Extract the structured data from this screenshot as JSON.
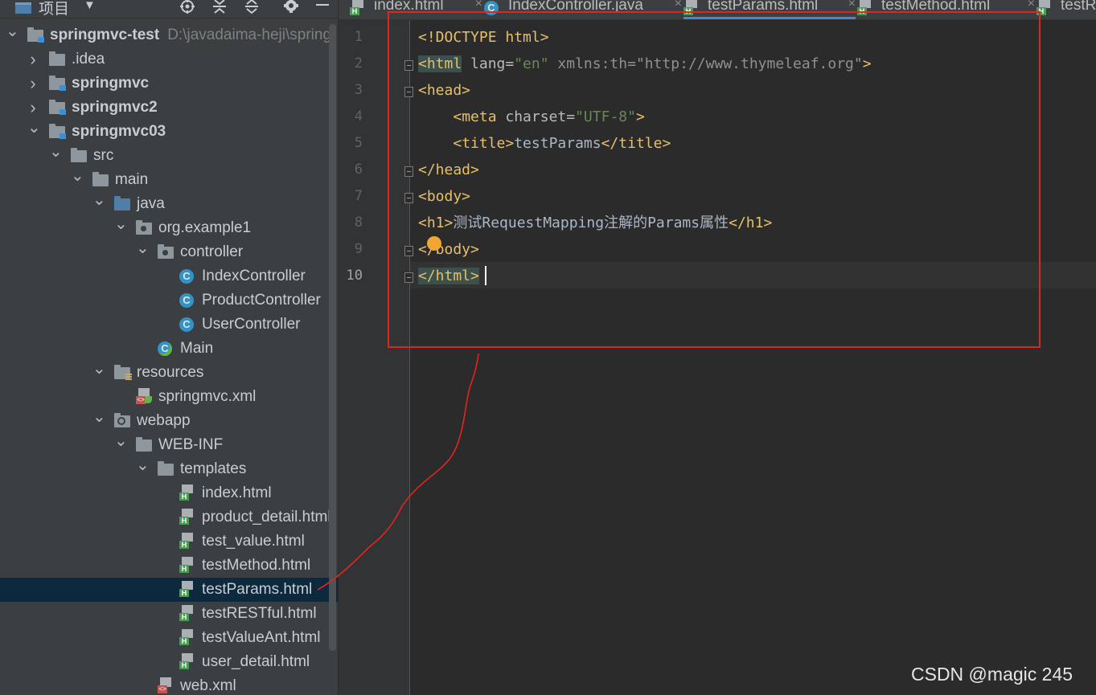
{
  "colors": {
    "panel_bg": "#3c3f41",
    "editor_bg": "#2b2b2b",
    "tag": "#e8bf6a",
    "string": "#6a8759",
    "selection": "#0d293e",
    "annotation": "#e0261e"
  },
  "project_panel": {
    "title": "项目",
    "toolbar_icons": [
      "folder-icon",
      "dropdown-arrow-icon",
      "locate-icon",
      "expand-all-icon",
      "collapse-all-icon",
      "gear-icon",
      "minimize-icon"
    ],
    "tree": [
      {
        "label": "springmvc-test",
        "path": "D:\\javadaima-heji\\spring",
        "icon": "module-folder-icon",
        "expanded": true,
        "bold": true
      },
      {
        "label": ".idea",
        "icon": "folder-icon",
        "expanded": false
      },
      {
        "label": "springmvc",
        "icon": "module-folder-icon",
        "expanded": false,
        "bold": true
      },
      {
        "label": "springmvc2",
        "icon": "module-folder-icon",
        "expanded": false,
        "bold": true
      },
      {
        "label": "springmvc03",
        "icon": "module-folder-icon",
        "expanded": true,
        "bold": true
      },
      {
        "label": "src",
        "icon": "folder-icon",
        "expanded": true
      },
      {
        "label": "main",
        "icon": "folder-icon",
        "expanded": true
      },
      {
        "label": "java",
        "icon": "source-folder-icon",
        "expanded": true
      },
      {
        "label": "org.example1",
        "icon": "package-icon",
        "expanded": true
      },
      {
        "label": "controller",
        "icon": "package-icon",
        "expanded": true
      },
      {
        "label": "IndexController",
        "icon": "class-icon"
      },
      {
        "label": "ProductController",
        "icon": "class-icon"
      },
      {
        "label": "UserController",
        "icon": "class-icon"
      },
      {
        "label": "Main",
        "icon": "main-class-icon"
      },
      {
        "label": "resources",
        "icon": "resources-folder-icon",
        "expanded": true
      },
      {
        "label": "springmvc.xml",
        "icon": "spring-xml-icon"
      },
      {
        "label": "webapp",
        "icon": "web-folder-icon",
        "expanded": true
      },
      {
        "label": "WEB-INF",
        "icon": "folder-icon",
        "expanded": true
      },
      {
        "label": "templates",
        "icon": "folder-icon",
        "expanded": true
      },
      {
        "label": "index.html",
        "icon": "html-file-icon"
      },
      {
        "label": "product_detail.html",
        "icon": "html-file-icon"
      },
      {
        "label": "test_value.html",
        "icon": "html-file-icon"
      },
      {
        "label": "testMethod.html",
        "icon": "html-file-icon"
      },
      {
        "label": "testParams.html",
        "icon": "html-file-icon",
        "selected": true
      },
      {
        "label": "testRESTful.html",
        "icon": "html-file-icon"
      },
      {
        "label": "testValueAnt.html",
        "icon": "html-file-icon"
      },
      {
        "label": "user_detail.html",
        "icon": "html-file-icon"
      },
      {
        "label": "web.xml",
        "icon": "web-xml-icon"
      }
    ]
  },
  "editor": {
    "tabs": [
      {
        "label": "index.html",
        "icon": "html-file-icon",
        "active": false,
        "close": "×"
      },
      {
        "label": "IndexController.java",
        "icon": "class-icon",
        "active": false,
        "close": "×"
      },
      {
        "label": "testParams.html",
        "icon": "html-file-icon",
        "active": true,
        "close": "×"
      },
      {
        "label": "testMethod.html",
        "icon": "html-file-icon",
        "active": false,
        "close": "×"
      },
      {
        "label": "testR",
        "icon": "html-file-icon",
        "active": false
      }
    ],
    "line_numbers": [
      "1",
      "2",
      "3",
      "4",
      "5",
      "6",
      "7",
      "8",
      "9",
      "10"
    ],
    "current_line": 10,
    "code": [
      [
        {
          "t": "<!DOCTYPE html>",
          "c": "tag"
        }
      ],
      [
        {
          "t": "<html",
          "c": "tag",
          "hl": true
        },
        {
          "t": " lang=",
          "c": "attr"
        },
        {
          "t": "\"en\"",
          "c": "val"
        },
        {
          "t": " xmlns:th=",
          "c": "dim"
        },
        {
          "t": "\"http://www.thymeleaf.org\"",
          "c": "dim"
        },
        {
          "t": ">",
          "c": "tag"
        }
      ],
      [
        {
          "t": "<head>",
          "c": "tag"
        }
      ],
      [
        {
          "t": "    ",
          "c": "text"
        },
        {
          "t": "<meta",
          "c": "tag"
        },
        {
          "t": " charset=",
          "c": "attr"
        },
        {
          "t": "\"UTF-8\"",
          "c": "val"
        },
        {
          "t": ">",
          "c": "tag"
        }
      ],
      [
        {
          "t": "    ",
          "c": "text"
        },
        {
          "t": "<title>",
          "c": "tag"
        },
        {
          "t": "testParams",
          "c": "text"
        },
        {
          "t": "</title>",
          "c": "tag"
        }
      ],
      [
        {
          "t": "</head>",
          "c": "tag"
        }
      ],
      [
        {
          "t": "<body>",
          "c": "tag"
        }
      ],
      [
        {
          "t": "<h1>",
          "c": "tag"
        },
        {
          "t": "测试RequestMapping注解的Params属性",
          "c": "text"
        },
        {
          "t": "</h1>",
          "c": "tag"
        }
      ],
      [
        {
          "t": "</body>",
          "c": "tag"
        }
      ],
      [
        {
          "t": "</html>",
          "c": "tag",
          "hl": true
        }
      ]
    ]
  },
  "watermark": "CSDN @magic 245"
}
